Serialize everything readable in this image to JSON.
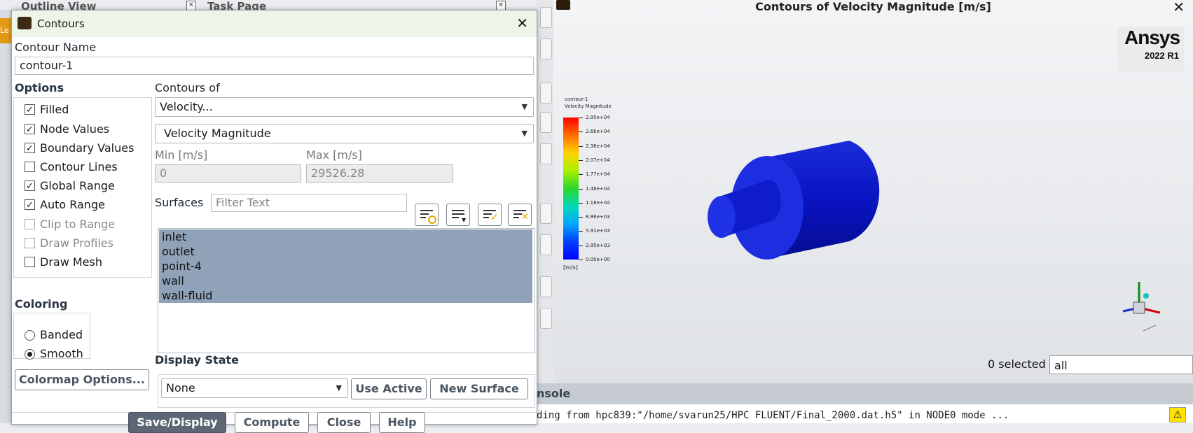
{
  "background": {
    "outline_view_title": "Outline View",
    "task_page_title": "Task Page",
    "left_tab": "Le"
  },
  "graphics": {
    "title": "Contours of Velocity Magnitude [m/s]",
    "logo_name": "Ansys",
    "logo_version": "2022 R1",
    "legend": {
      "title_line1": "contour-1",
      "title_line2": "Velocity Magnitude",
      "ticks": [
        "2.95e+04",
        "2.66e+04",
        "2.36e+04",
        "2.07e+04",
        "1.77e+04",
        "1.48e+04",
        "1.18e+04",
        "8.86e+03",
        "5.91e+03",
        "2.95e+03",
        "0.00e+00"
      ],
      "unit": "[m/s]"
    },
    "selected_label": "0 selected",
    "filter_value": "all"
  },
  "console": {
    "label": "nsole",
    "line": "ding from hpc839:\"/home/svarun25/HPC FLUENT/Final_2000.dat.h5\" in NODE0 mode ..."
  },
  "dialog": {
    "title": "Contours",
    "contour_name_label": "Contour Name",
    "contour_name_value": "contour-1",
    "options_label": "Options",
    "options": [
      {
        "label": "Filled",
        "checked": true,
        "enabled": true
      },
      {
        "label": "Node Values",
        "checked": true,
        "enabled": true
      },
      {
        "label": "Boundary Values",
        "checked": true,
        "enabled": true
      },
      {
        "label": "Contour Lines",
        "checked": false,
        "enabled": true
      },
      {
        "label": "Global Range",
        "checked": true,
        "enabled": true
      },
      {
        "label": "Auto Range",
        "checked": true,
        "enabled": true
      },
      {
        "label": "Clip to Range",
        "checked": false,
        "enabled": false
      },
      {
        "label": "Draw Profiles",
        "checked": false,
        "enabled": false
      },
      {
        "label": "Draw Mesh",
        "checked": false,
        "enabled": true
      }
    ],
    "contours_of_label": "Contours of",
    "contours_of_value": "Velocity...",
    "contours_sub_value": "Velocity Magnitude",
    "min_label": "Min [m/s]",
    "min_value": "0",
    "max_label": "Max [m/s]",
    "max_value": "29526.28",
    "surfaces_label": "Surfaces",
    "filter_placeholder": "Filter Text",
    "surfaces": [
      "inlet",
      "outlet",
      "point-4",
      "wall",
      "wall-fluid"
    ],
    "coloring_label": "Coloring",
    "coloring_options": [
      {
        "label": "Banded",
        "selected": false
      },
      {
        "label": "Smooth",
        "selected": true
      }
    ],
    "colormap_button": "Colormap Options...",
    "display_state_label": "Display State",
    "display_state_value": "None",
    "use_active_button": "Use Active",
    "new_surface_button": "New Surface",
    "footer_buttons": [
      "Save/Display",
      "Compute",
      "Close",
      "Help"
    ]
  }
}
